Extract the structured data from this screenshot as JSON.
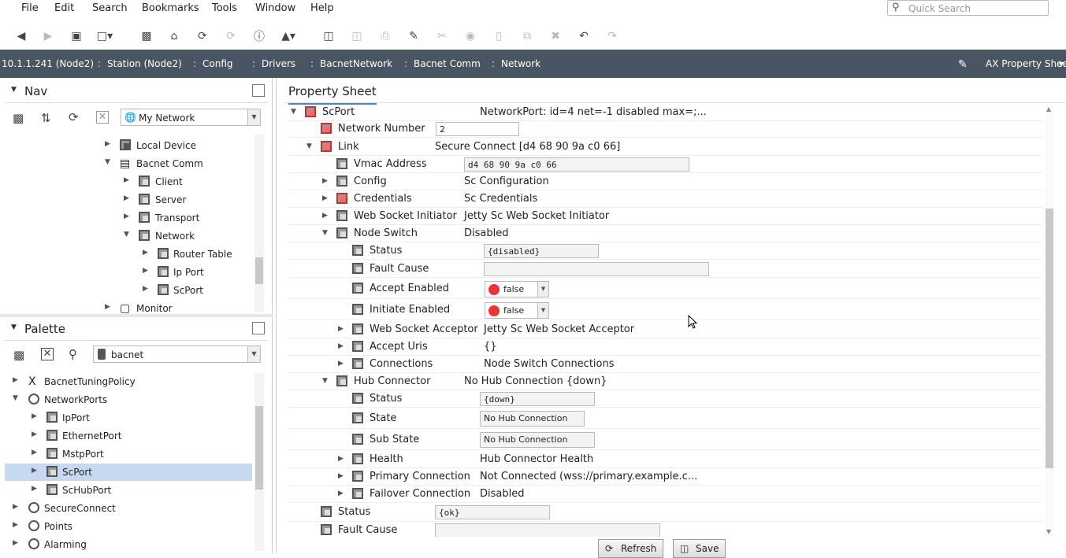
{
  "menubar": {
    "items": [
      "File",
      "Edit",
      "Search",
      "Bookmarks",
      "Tools",
      "Window",
      "Help"
    ]
  },
  "quick_search": {
    "placeholder": "Quick Search"
  },
  "toolbar": {
    "icons": [
      "back-icon",
      "forward-icon",
      "up-level-icon",
      "view-icon",
      "folder-icon",
      "home-icon",
      "refresh-icon",
      "refresh-disabled-icon",
      "info-icon",
      "open-icon",
      "save-icon",
      "save-all-icon",
      "export-icon",
      "edit-icon",
      "cut-icon",
      "copy-icon",
      "paste-icon",
      "duplicate-icon",
      "delete-icon",
      "undo-icon",
      "redo-icon"
    ]
  },
  "pathbar": {
    "segments": [
      "10.1.1.241 (Node2)",
      "Station (Node2)",
      "Config",
      "Drivers",
      "BacnetNetwork",
      "Bacnet Comm",
      "Network"
    ],
    "view_label": "AX Property Sheet"
  },
  "nav": {
    "title": "Nav",
    "selector": "My Network",
    "items": [
      {
        "label": "Local Device"
      },
      {
        "label": "Bacnet Comm"
      },
      {
        "label": "Client"
      },
      {
        "label": "Server"
      },
      {
        "label": "Transport"
      },
      {
        "label": "Network"
      },
      {
        "label": "Router Table"
      },
      {
        "label": "Ip Port"
      },
      {
        "label": "ScPort"
      },
      {
        "label": "Monitor"
      }
    ]
  },
  "palette": {
    "title": "Palette",
    "selector": "bacnet",
    "items": [
      {
        "label": "BacnetTuningPolicy"
      },
      {
        "label": "NetworkPorts"
      },
      {
        "label": "IpPort"
      },
      {
        "label": "EthernetPort"
      },
      {
        "label": "MstpPort"
      },
      {
        "label": "ScPort"
      },
      {
        "label": "ScHubPort"
      },
      {
        "label": "SecureConnect"
      },
      {
        "label": "Points"
      },
      {
        "label": "Alarming"
      }
    ]
  },
  "property_sheet": {
    "tab_label": "Property Sheet",
    "rows": [
      {
        "name": "ScPort",
        "value": "NetworkPort: id=4 net=-1 disabled max=;..."
      },
      {
        "name": "Network Number",
        "value": "2"
      },
      {
        "name": "Link",
        "value": "Secure Connect [d4 68 90 9a c0 66]"
      },
      {
        "name": "Vmac Address",
        "value": "d4 68 90 9a c0 66"
      },
      {
        "name": "Config",
        "value": "Sc Configuration"
      },
      {
        "name": "Credentials",
        "value": "Sc Credentials"
      },
      {
        "name": "Web Socket Initiator",
        "value": "Jetty Sc Web Socket Initiator"
      },
      {
        "name": "Node Switch",
        "value": "Disabled"
      },
      {
        "name": "Status",
        "value": "{disabled}"
      },
      {
        "name": "Fault Cause",
        "value": ""
      },
      {
        "name": "Accept Enabled",
        "value": "false"
      },
      {
        "name": "Initiate Enabled",
        "value": "false"
      },
      {
        "name": "Web Socket Acceptor",
        "value": "Jetty Sc Web Socket Acceptor"
      },
      {
        "name": "Accept Uris",
        "value": "{}"
      },
      {
        "name": "Connections",
        "value": "Node Switch Connections"
      },
      {
        "name": "Hub Connector",
        "value": "No Hub Connection {down}"
      },
      {
        "name": "Status",
        "value": "{down}"
      },
      {
        "name": "State",
        "value": "No Hub Connection"
      },
      {
        "name": "Sub State",
        "value": "No Hub Connection"
      },
      {
        "name": "Health",
        "value": "Hub Connector Health"
      },
      {
        "name": "Primary Connection",
        "value": "Not Connected (wss://primary.example.c..."
      },
      {
        "name": "Failover Connection",
        "value": "Disabled"
      },
      {
        "name": "Status",
        "value": "{ok}"
      },
      {
        "name": "Fault Cause",
        "value": ""
      }
    ]
  },
  "buttons": {
    "refresh": "Refresh",
    "save": "Save"
  },
  "colors": {
    "pathbar": "#4a5563",
    "selection": "#c6d9f1",
    "false_dot": "#e33"
  }
}
